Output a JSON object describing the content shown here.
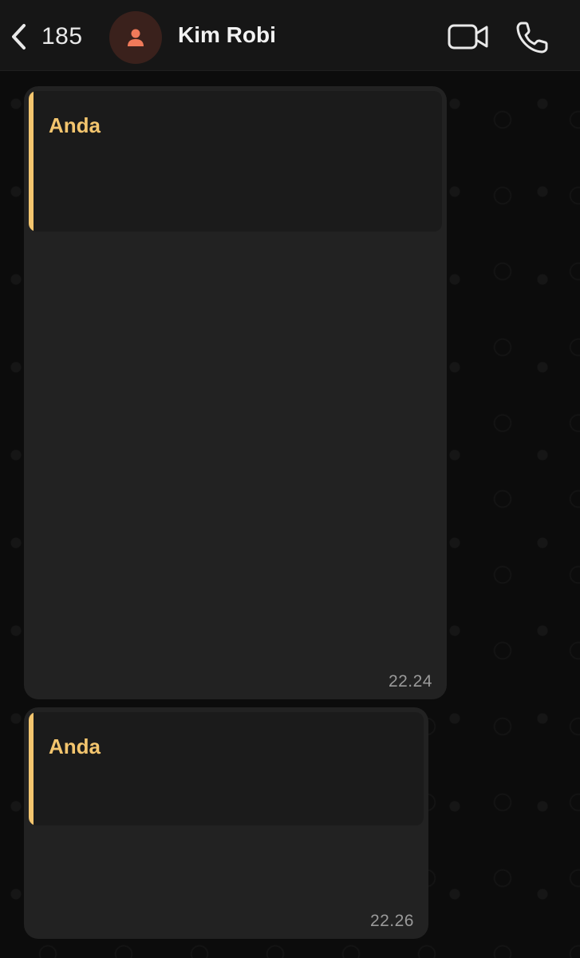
{
  "header": {
    "back_count": "185",
    "contact_name": "Kim Robi",
    "icons": {
      "back": "chevron-left-icon",
      "avatar": "person-icon",
      "video": "video-camera-icon",
      "call": "phone-icon"
    }
  },
  "messages": [
    {
      "quote_author": "Anda",
      "time": "22.24"
    },
    {
      "quote_author": "Anda",
      "time": "22.26"
    }
  ],
  "colors": {
    "quote_accent": "#f3c56e",
    "avatar_icon": "#f07a5a",
    "bubble": "#222222",
    "header": "#161616"
  }
}
